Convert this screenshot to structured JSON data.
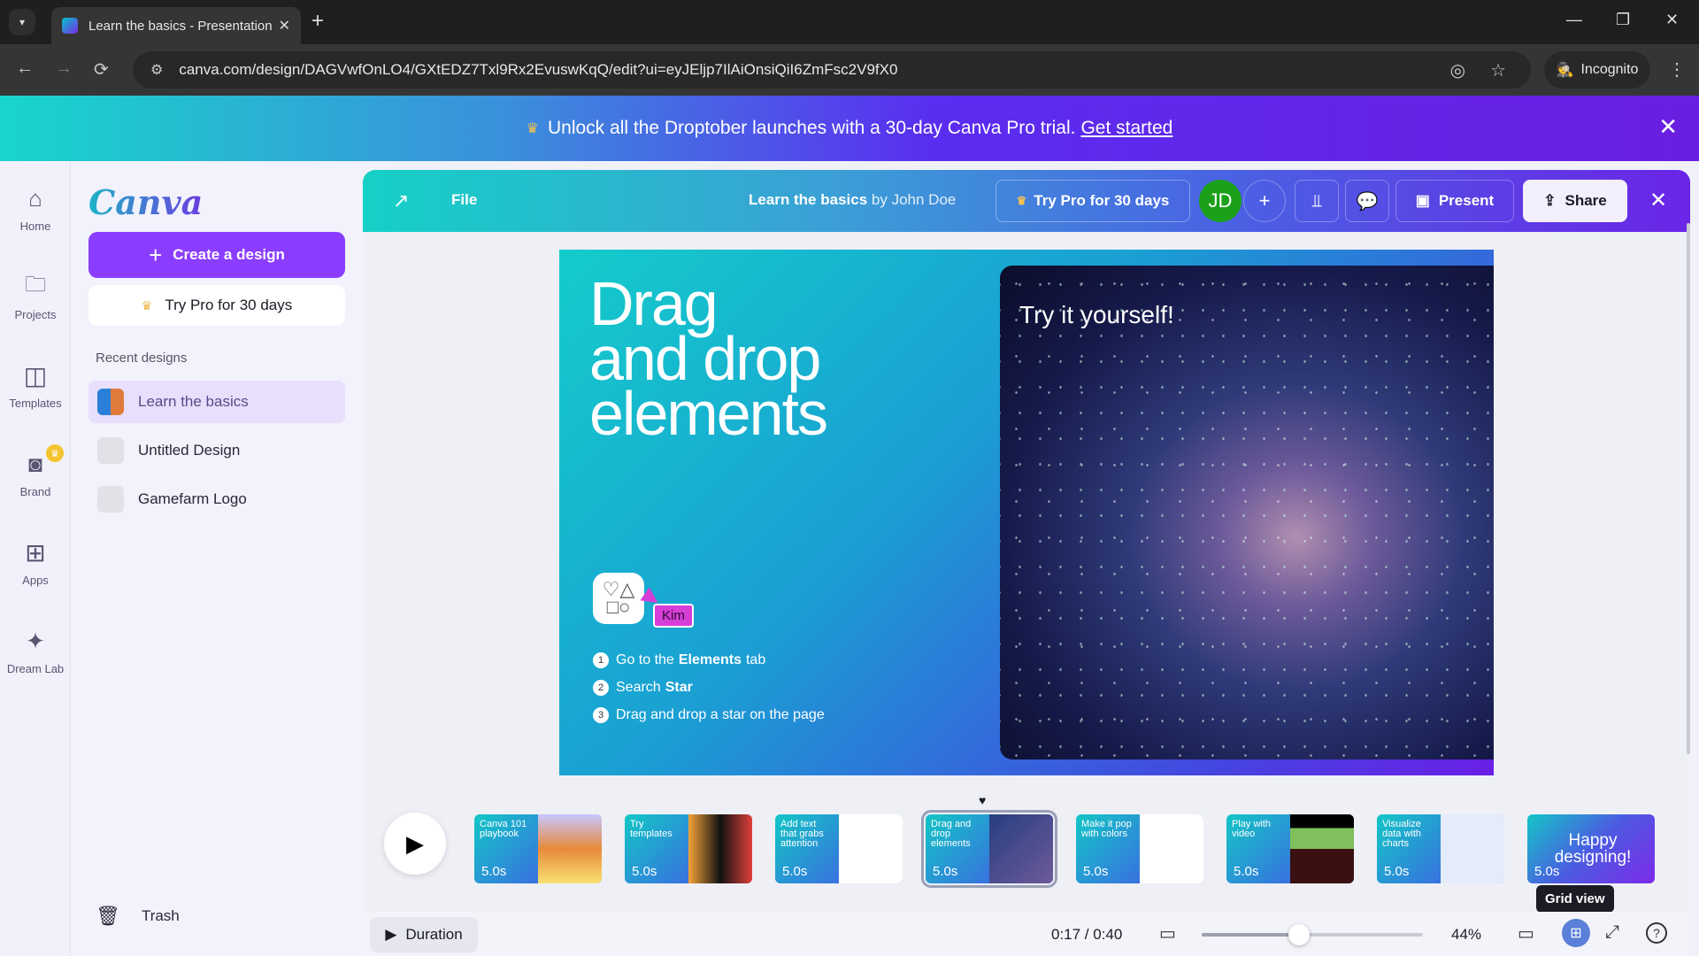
{
  "browser": {
    "tab_title": "Learn the basics - Presentation",
    "url": "canva.com/design/DAGVwfOnLO4/GXtEDZ7Txl9Rx2EvuswKqQ/edit?ui=eyJEljp7IlAiOnsiQiI6ZmFsc2V9fX0",
    "incognito_label": "Incognito",
    "icons": {
      "tab_dropdown": "▾",
      "new_tab": "+",
      "back": "←",
      "forward": "→",
      "reload": "⟳",
      "site_settings": "⚙",
      "eye_off": "◎",
      "star": "☆",
      "incognito": "🕵",
      "menu": "⋮",
      "minimize": "—",
      "restore": "❐",
      "close": "✕",
      "tab_close": "✕"
    }
  },
  "promo": {
    "text": "Unlock all the Droptober launches with a 30-day Canva Pro trial.",
    "link": "Get started",
    "crown": "♛",
    "close": "✕"
  },
  "rail": {
    "items": [
      {
        "label": "Home",
        "icon": "⌂"
      },
      {
        "label": "Projects",
        "icon": "🗀"
      },
      {
        "label": "Templates",
        "icon": "◫"
      },
      {
        "label": "Brand",
        "icon": "◙",
        "badge": "♛"
      },
      {
        "label": "Apps",
        "icon": "⊞"
      },
      {
        "label": "Dream Lab",
        "icon": "✦"
      }
    ]
  },
  "panel": {
    "logo": "Canva",
    "create_label": "Create a design",
    "create_icon": "+",
    "pro_label": "Try Pro for 30 days",
    "pro_icon": "♛",
    "recent_label": "Recent designs",
    "recent": [
      {
        "name": "Learn the basics",
        "active": true
      },
      {
        "name": "Untitled Design",
        "active": false
      },
      {
        "name": "Gamefarm Logo",
        "active": false
      }
    ],
    "trash_label": "Trash",
    "trash_icon": "🗑"
  },
  "toolbar": {
    "external_icon": "↗",
    "file": "File",
    "title": "Learn the basics",
    "by": "by John Doe",
    "pro": "Try Pro for 30 days",
    "pro_icon": "♛",
    "avatar": "JD",
    "add": "+",
    "insights_icon": "⫫",
    "comment_icon": "💬",
    "present": "Present",
    "present_icon": "▣",
    "share": "Share",
    "share_icon": "⇪",
    "close": "✕"
  },
  "slide": {
    "title_lines": [
      "Drag",
      "and drop",
      "elements"
    ],
    "try_text": "Try it yourself!",
    "elements_icon": "♡△\n□○",
    "cursor_name": "Kim",
    "steps": [
      {
        "n": "1",
        "pre": "Go to the",
        "bold": "Elements",
        "post": "tab"
      },
      {
        "n": "2",
        "pre": "Search",
        "bold": "Star",
        "post": ""
      },
      {
        "n": "3",
        "pre": "Drag and drop a star on the page",
        "bold": "",
        "post": ""
      }
    ]
  },
  "timeline": {
    "play_icon": "▶",
    "playhead_icon": "♥",
    "thumbnails": [
      {
        "label": "Canva 101 playbook",
        "duration": "5.0s",
        "kind": "photo"
      },
      {
        "label": "Try templates",
        "duration": "5.0s",
        "kind": "tpl"
      },
      {
        "label": "Add text that grabs attention",
        "duration": "5.0s",
        "kind": "white"
      },
      {
        "label": "Drag and drop elements",
        "duration": "5.0s",
        "kind": "space2",
        "selected": true
      },
      {
        "label": "Make it pop with colors",
        "duration": "5.0s",
        "kind": "white"
      },
      {
        "label": "Play with video",
        "duration": "5.0s",
        "kind": "video"
      },
      {
        "label": "Visualize data with charts",
        "duration": "5.0s",
        "kind": "chart"
      },
      {
        "label": "Happy designing!",
        "duration": "5.0s",
        "kind": "last"
      }
    ],
    "tooltip": "Grid view"
  },
  "bottombar": {
    "duration_label": "Duration",
    "duration_icon": "▶",
    "timecode": "0:17 / 0:40",
    "zoom_percent": "44%",
    "zoom_value": 0.44,
    "icons": {
      "notes": "▭",
      "pages": "▭",
      "grid": "⊞",
      "fullscreen": "⤢",
      "help": "?"
    }
  }
}
